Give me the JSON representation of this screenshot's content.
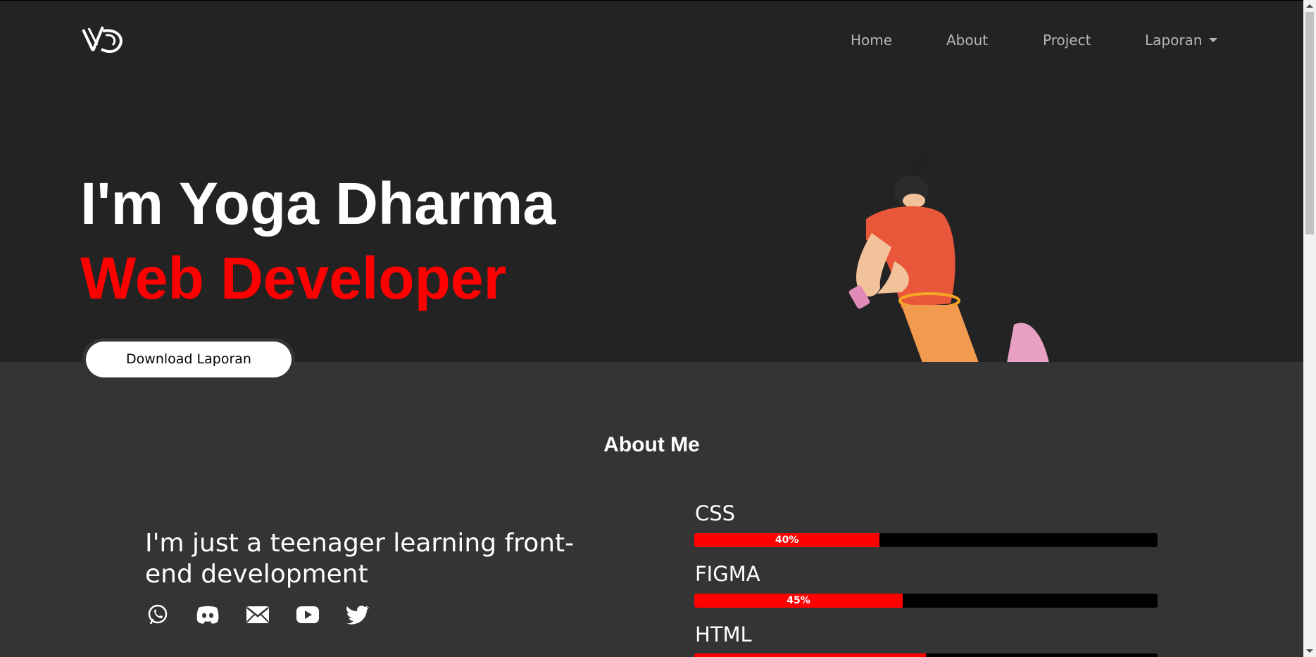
{
  "nav": {
    "logo": "YD",
    "items": [
      {
        "label": "Home"
      },
      {
        "label": "About"
      },
      {
        "label": "Project"
      },
      {
        "label": "Laporan"
      }
    ]
  },
  "hero": {
    "title": "I'm Yoga Dharma",
    "subtitle": "Web Developer",
    "button": "Download Laporan"
  },
  "about": {
    "title": "About Me",
    "tagline": "I'm just a teenager learning front-end development",
    "socials": [
      "whatsapp-icon",
      "discord-icon",
      "mail-icon",
      "youtube-icon",
      "twitter-icon"
    ]
  },
  "skills": [
    {
      "name": "CSS",
      "percent": 40,
      "label": "40%"
    },
    {
      "name": "FIGMA",
      "percent": 45,
      "label": "45%"
    },
    {
      "name": "HTML",
      "percent": 50,
      "label": ""
    }
  ],
  "colors": {
    "accent": "#ff0000",
    "bg": "#232324",
    "bg_lower": "#343435"
  }
}
